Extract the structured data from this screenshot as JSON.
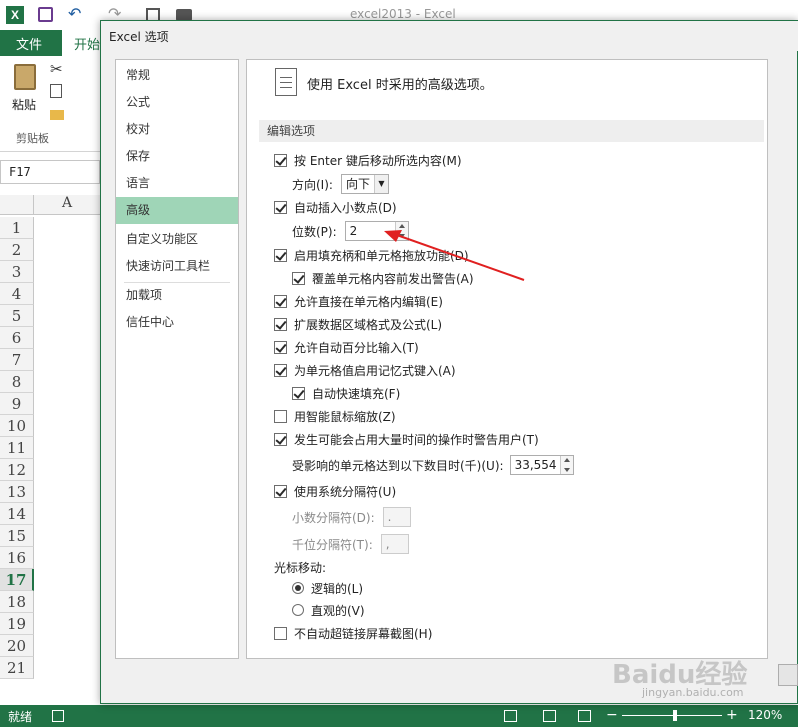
{
  "app": {
    "title": "excel2013 - Excel",
    "file_tab": "文件",
    "home_tab": "开始"
  },
  "ribbon": {
    "paste_label": "粘贴",
    "clipboard_label": "剪贴板"
  },
  "name_box": "F17",
  "column_a": "A",
  "rows": [
    "1",
    "2",
    "3",
    "4",
    "5",
    "6",
    "7",
    "8",
    "9",
    "10",
    "11",
    "12",
    "13",
    "14",
    "15",
    "16",
    "17",
    "18",
    "19",
    "20",
    "21"
  ],
  "status": {
    "ready": "就绪",
    "zoom": "120%"
  },
  "dialog": {
    "title": "Excel 选项",
    "nav": [
      "常规",
      "公式",
      "校对",
      "保存",
      "语言",
      "高级",
      "自定义功能区",
      "快速访问工具栏",
      "加载项",
      "信任中心"
    ],
    "header_text": "使用 Excel 时采用的高级选项。",
    "section_title": "编辑选项",
    "opt_enter_move": "按 Enter 键后移动所选内容(M)",
    "direction_label": "方向(I):",
    "direction_value": "向下",
    "opt_auto_decimal": "自动插入小数点(D)",
    "places_label": "位数(P):",
    "places_value": "2",
    "opt_fill_handle": "启用填充柄和单元格拖放功能(D)",
    "opt_overwrite_alert": "覆盖单元格内容前发出警告(A)",
    "opt_edit_in_cell": "允许直接在单元格内编辑(E)",
    "opt_extend_formats": "扩展数据区域格式及公式(L)",
    "opt_auto_percent": "允许自动百分比输入(T)",
    "opt_autocomplete": "为单元格值启用记忆式键入(A)",
    "opt_flash_fill": "自动快速填充(F)",
    "opt_intellimouse": "用智能鼠标缩放(Z)",
    "opt_alert_slow": "发生可能会占用大量时间的操作时警告用户(T)",
    "cells_affected_label": "受影响的单元格达到以下数目时(千)(U):",
    "cells_affected_value": "33,554",
    "opt_system_separators": "使用系统分隔符(U)",
    "decimal_sep_label": "小数分隔符(D):",
    "decimal_sep_value": ".",
    "thousands_sep_label": "千位分隔符(T):",
    "thousands_sep_value": ",",
    "cursor_movement_label": "光标移动:",
    "cursor_logical": "逻辑的(L)",
    "cursor_visual": "直观的(V)",
    "opt_no_hyperlink_screenshot": "不自动超链接屏幕截图(H)"
  },
  "watermark": {
    "brand": "Baidu经验",
    "url": "jingyan.baidu.com"
  },
  "colors": {
    "excel_green": "#217346",
    "nav_selected": "#9fd5b7",
    "arrow": "#e02020"
  }
}
